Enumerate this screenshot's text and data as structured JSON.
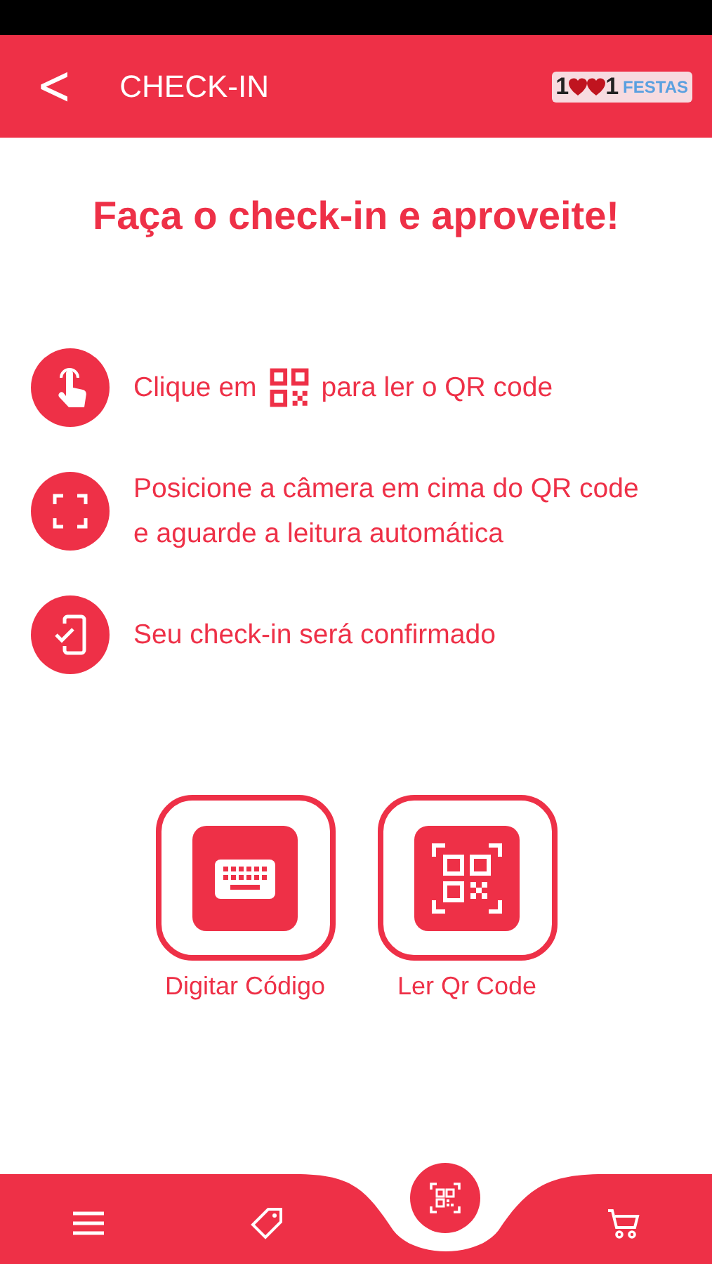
{
  "header": {
    "back": "<",
    "title": "CHECK-IN",
    "logo": {
      "lead": "1",
      "trail": "1",
      "word": "FESTAS"
    }
  },
  "heading": "Faça o check-in e aproveite!",
  "steps": [
    {
      "kind": "tap",
      "before": "Clique em",
      "after": "para ler o QR code"
    },
    {
      "kind": "scan",
      "text": "Posicione a câmera em cima do QR code e aguarde a leitura automática"
    },
    {
      "kind": "confirm",
      "text": "Seu check-in será confirmado"
    }
  ],
  "actions": [
    {
      "kind": "keyboard",
      "label": "Digitar Código"
    },
    {
      "kind": "qr",
      "label": "Ler Qr Code"
    }
  ],
  "nav": [
    {
      "kind": "menu"
    },
    {
      "kind": "tag"
    },
    {
      "kind": "scan"
    },
    {
      "kind": "cart"
    }
  ]
}
